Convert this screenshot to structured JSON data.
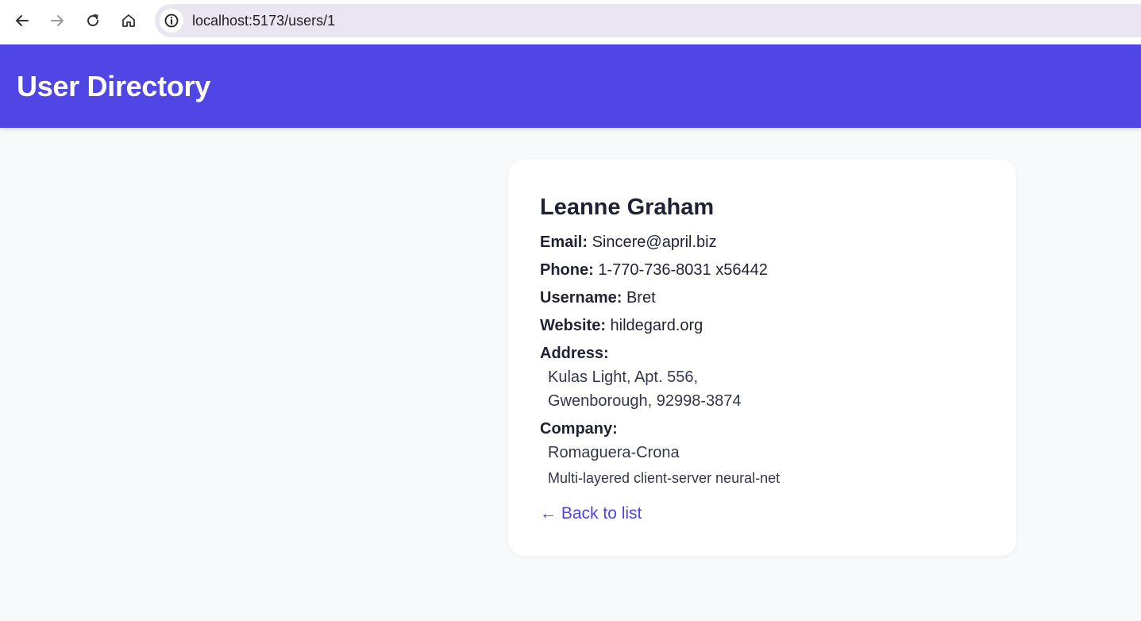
{
  "browser": {
    "url": "localhost:5173/users/1",
    "icons": {
      "back": "arrow-left-icon",
      "forward": "arrow-right-icon",
      "reload": "reload-icon",
      "home": "home-icon",
      "info": "info-icon"
    }
  },
  "header": {
    "title": "User Directory",
    "background_color": "#4f46e5"
  },
  "user": {
    "name": "Leanne Graham",
    "email_label": "Email:",
    "email": "Sincere@april.biz",
    "phone_label": "Phone:",
    "phone": "1-770-736-8031 x56442",
    "username_label": "Username:",
    "username": "Bret",
    "website_label": "Website:",
    "website": "hildegard.org",
    "address_label": "Address:",
    "address_line1": "Kulas Light, Apt. 556,",
    "address_line2": "Gwenborough, 92998-3874",
    "company_label": "Company:",
    "company_name": "Romaguera-Crona",
    "company_catchphrase": "Multi-layered client-server neural-net"
  },
  "back_link": {
    "label": "← Back to list",
    "color": "#4f46e5"
  }
}
